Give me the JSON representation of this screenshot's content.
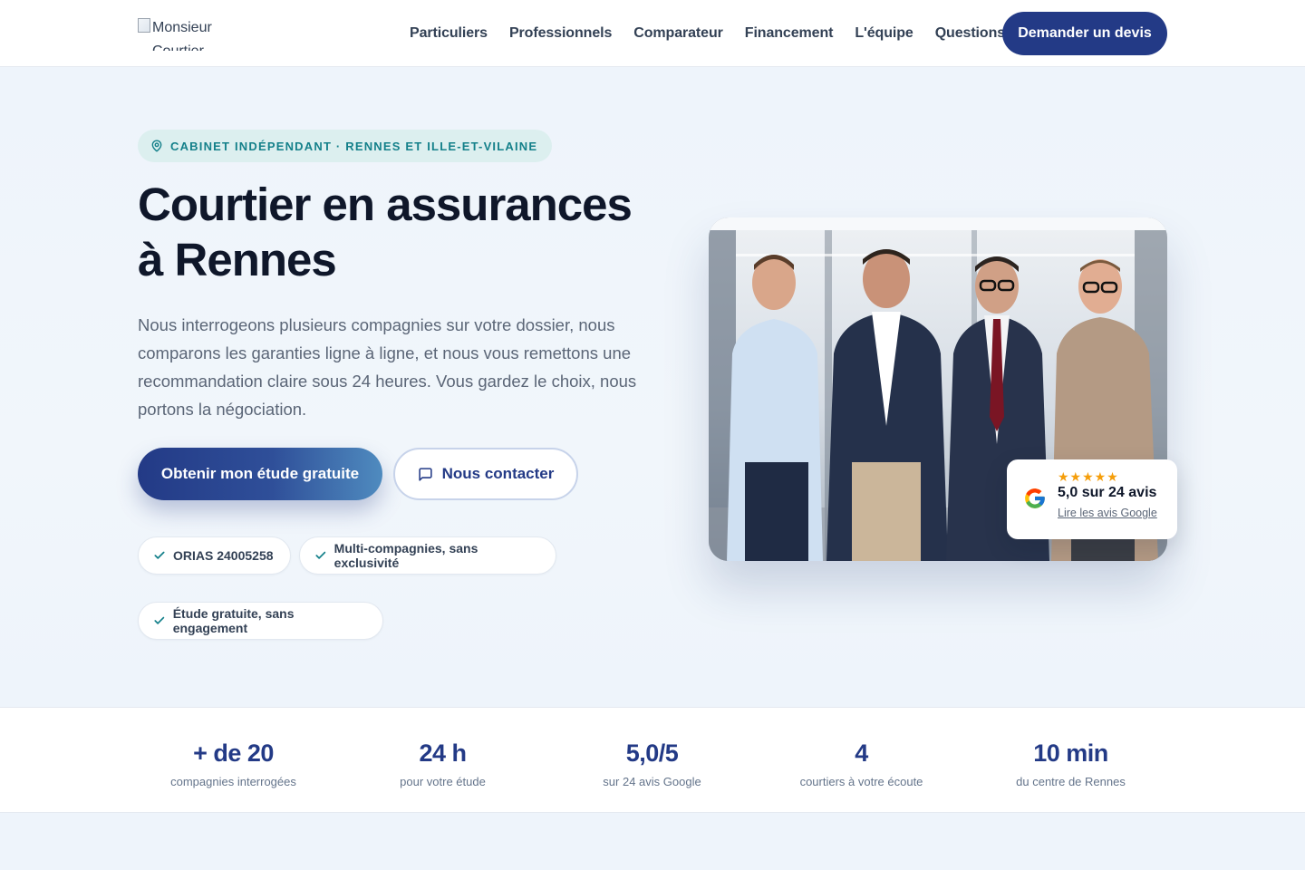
{
  "header": {
    "logo_alt": "Monsieur Courtier",
    "nav": [
      "Particuliers",
      "Professionnels",
      "Comparateur",
      "Financement",
      "L'équipe",
      "Questions"
    ],
    "cta": "Demander un devis"
  },
  "hero": {
    "badge": "CABINET INDÉPENDANT · RENNES ET ILLE-ET-VILAINE",
    "title_line1": "Courtier en assurances",
    "title_line2": "à Rennes",
    "lead": "Nous interrogeons plusieurs compagnies sur votre dossier, nous comparons les garanties ligne à ligne, et nous vous remettons une recommandation claire sous 24 heures. Vous gardez le choix, nous portons la négociation.",
    "primary_button": "Obtenir mon étude gratuite",
    "secondary_button": "Nous contacter",
    "chips": [
      "ORIAS 24005258",
      "Multi-compagnies, sans exclusivité",
      "Étude gratuite, sans engagement"
    ]
  },
  "review": {
    "stars": "★★★★★",
    "score": "5,0 sur 24 avis",
    "link": "Lire les avis Google"
  },
  "stats": [
    {
      "value": "+ de 20",
      "label": "compagnies interrogées"
    },
    {
      "value": "24 h",
      "label": "pour votre étude"
    },
    {
      "value": "5,0/5",
      "label": "sur 24 avis Google"
    },
    {
      "value": "4",
      "label": "courtiers à votre écoute"
    },
    {
      "value": "10 min",
      "label": "du centre de Rennes"
    }
  ],
  "colors": {
    "brand": "#233a86",
    "teal": "#14808a",
    "star": "#f59e0b"
  }
}
